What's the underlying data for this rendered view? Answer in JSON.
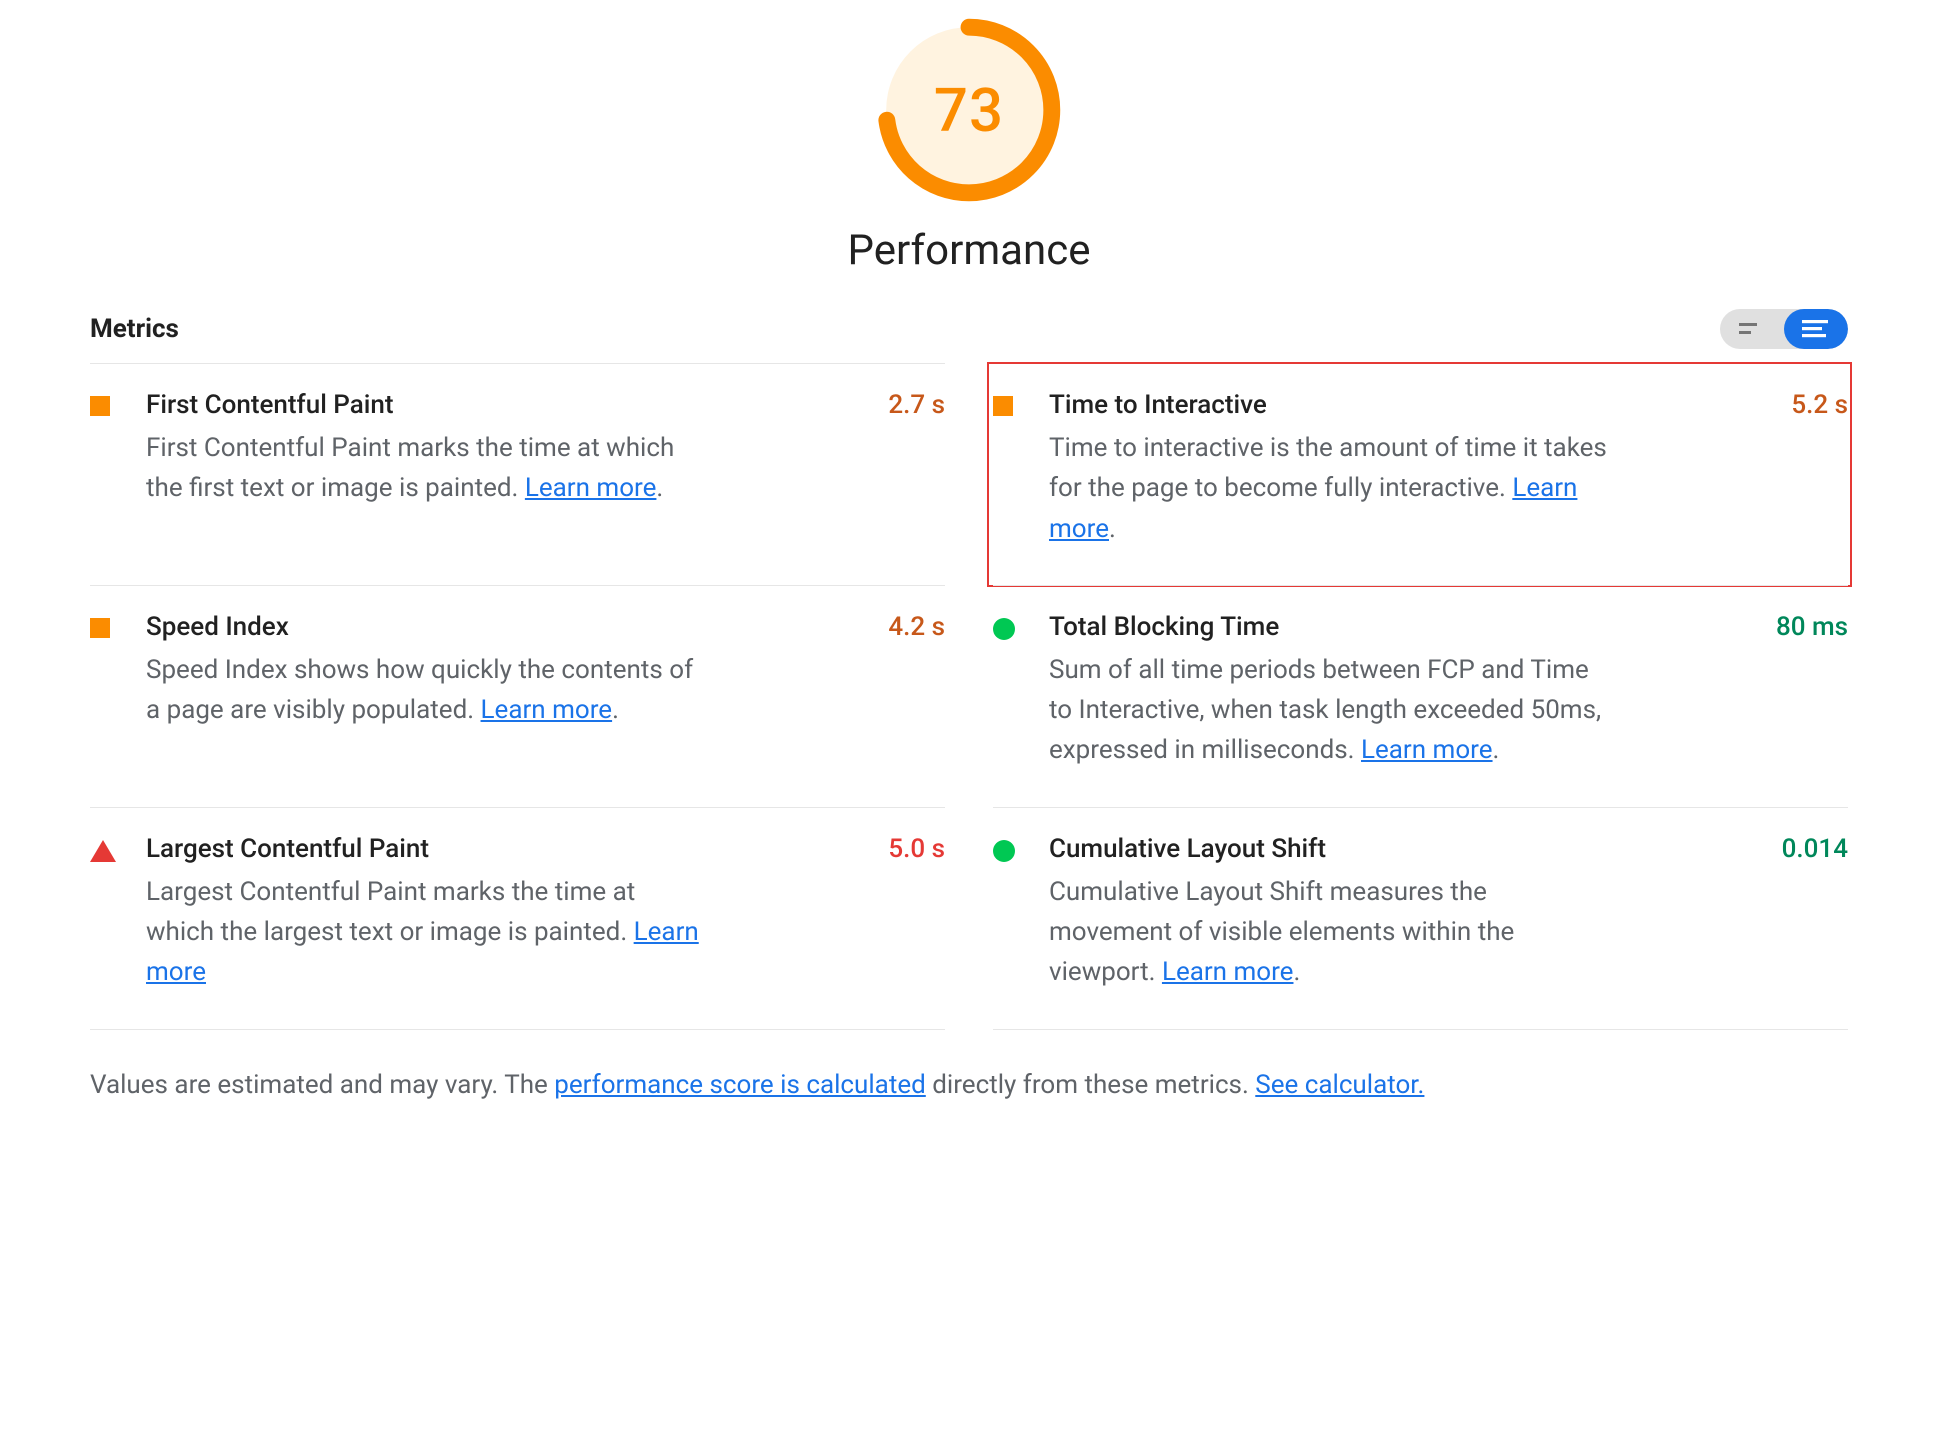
{
  "gauge": {
    "score": "73",
    "label": "Performance",
    "percent": 73
  },
  "metrics_heading": "Metrics",
  "learn_more": "Learn more",
  "metrics": {
    "fcp": {
      "title": "First Contentful Paint",
      "desc": "First Contentful Paint marks the time at which the first text or image is painted. ",
      "value": "2.7 s",
      "status": "average"
    },
    "tti": {
      "title": "Time to Interactive",
      "desc": "Time to interactive is the amount of time it takes for the page to become fully interactive. ",
      "value": "5.2 s",
      "status": "average"
    },
    "si": {
      "title": "Speed Index",
      "desc": "Speed Index shows how quickly the contents of a page are visibly populated. ",
      "value": "4.2 s",
      "status": "average"
    },
    "tbt": {
      "title": "Total Blocking Time",
      "desc": "Sum of all time periods between FCP and Time to Interactive, when task length exceeded 50ms, expressed in milliseconds. ",
      "value": "80 ms",
      "status": "good"
    },
    "lcp": {
      "title": "Largest Contentful Paint",
      "desc": "Largest Contentful Paint marks the time at which the largest text or image is painted. ",
      "value": "5.0 s",
      "status": "poor"
    },
    "cls": {
      "title": "Cumulative Layout Shift",
      "desc": "Cumulative Layout Shift measures the movement of visible elements within the viewport. ",
      "value": "0.014",
      "status": "good"
    }
  },
  "footnote": {
    "prefix": "Values are estimated and may vary. The ",
    "link1": "performance score is calculated",
    "middle": " directly from these metrics. ",
    "link2": "See calculator."
  }
}
